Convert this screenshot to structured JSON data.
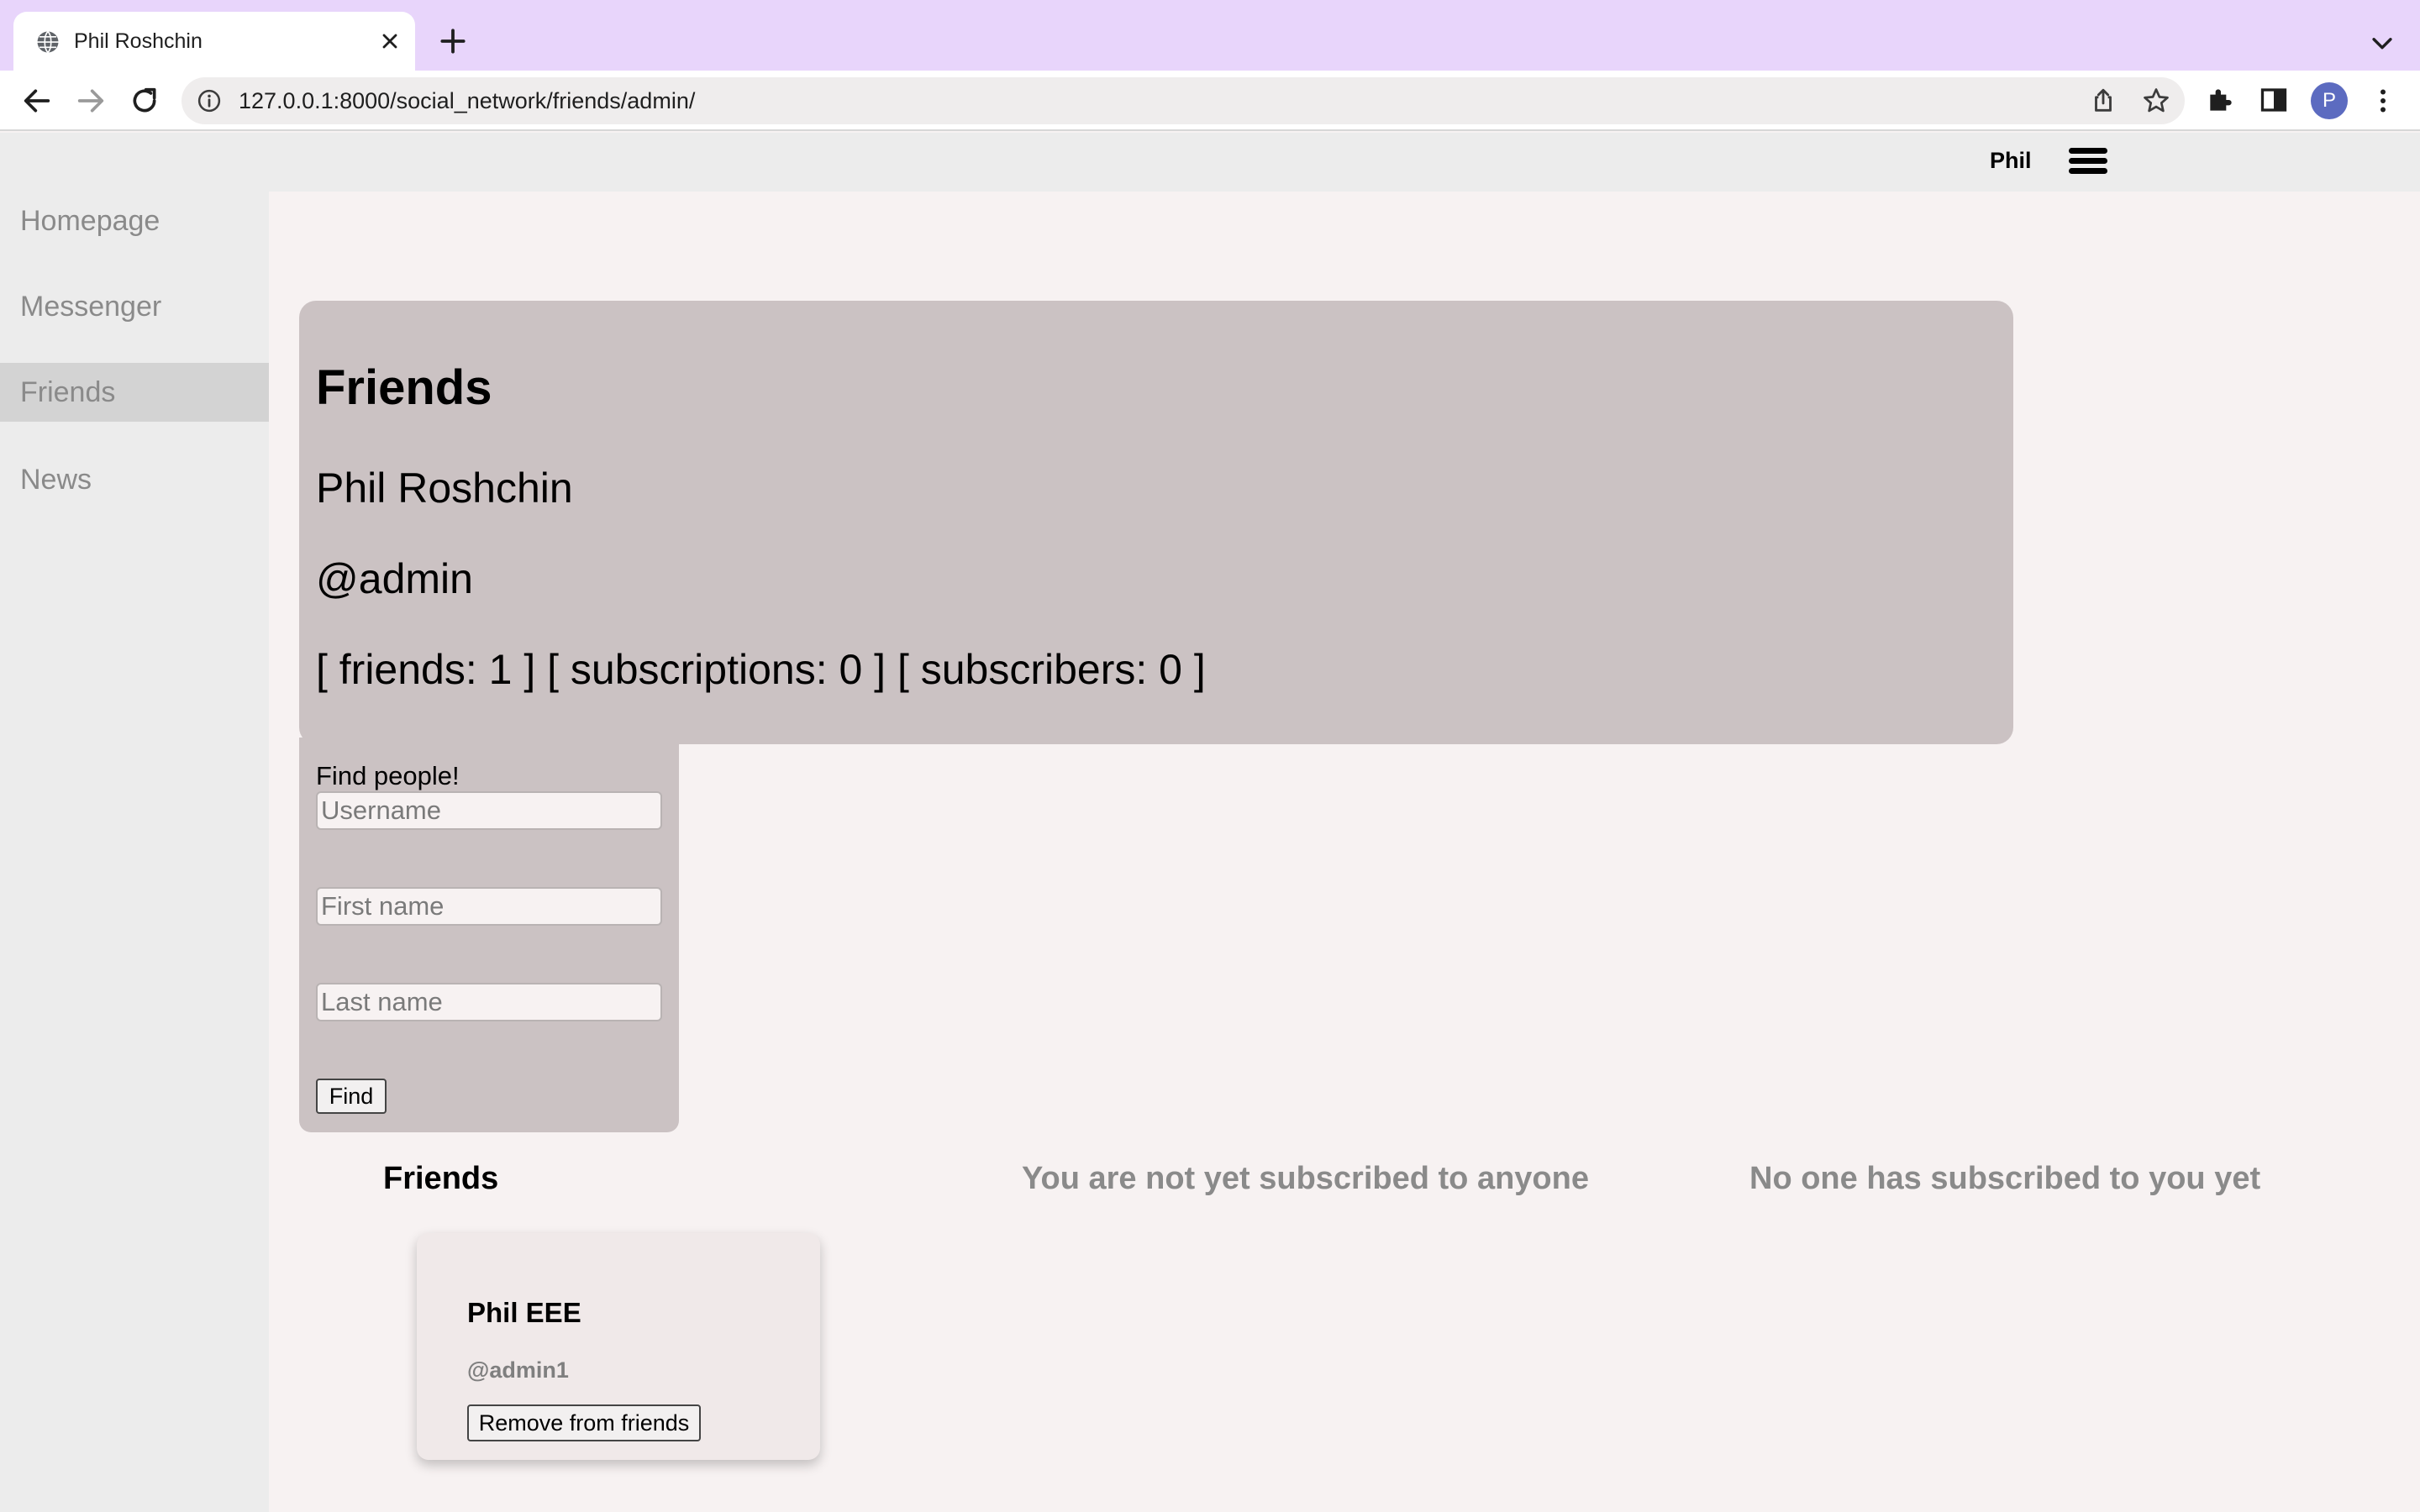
{
  "browser": {
    "tab_title": "Phil Roshchin",
    "url": "127.0.0.1:8000/social_network/friends/admin/",
    "profile_initial": "P",
    "accent_color": "#e8d5fb"
  },
  "topbar": {
    "username": "Phil"
  },
  "sidebar": {
    "items": [
      {
        "label": "Homepage"
      },
      {
        "label": "Messenger"
      },
      {
        "label": "Friends",
        "active": true
      },
      {
        "label": "News"
      }
    ]
  },
  "profile": {
    "heading": "Friends",
    "full_name": "Phil Roshchin",
    "handle": "@admin",
    "stats": "[ friends: 1 ] [ subscriptions: 0 ] [ subscribers: 0 ]"
  },
  "search": {
    "label": "Find people!",
    "username_placeholder": "Username",
    "first_name_placeholder": "First name",
    "last_name_placeholder": "Last name",
    "button_label": "Find"
  },
  "columns": {
    "friends_title": "Friends",
    "subscriptions_empty": "You are not yet subscribed to anyone",
    "subscribers_empty": "No one has subscribed to you yet"
  },
  "friends": [
    {
      "name": "Phil EEE",
      "handle": "@admin1",
      "action_label": "Remove from friends"
    }
  ]
}
